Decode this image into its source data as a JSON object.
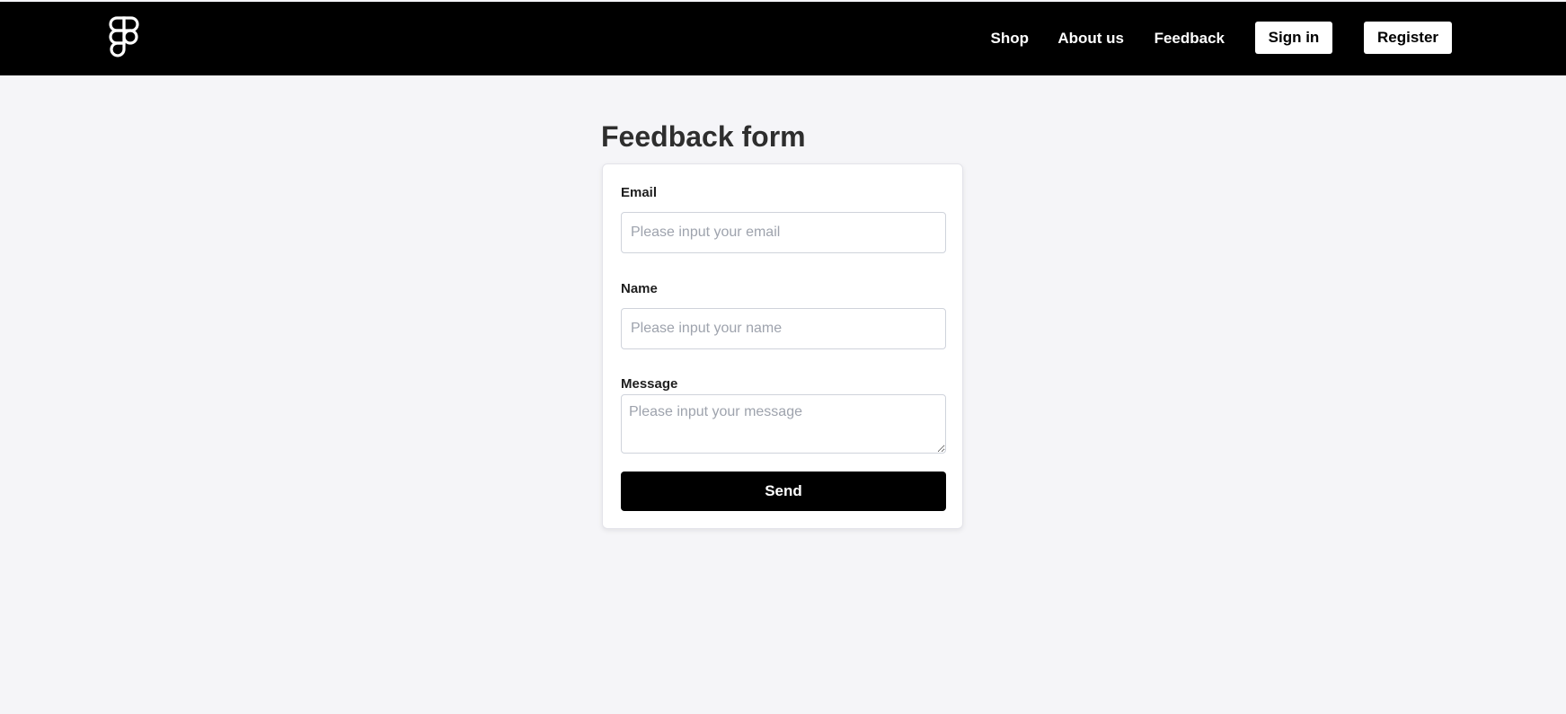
{
  "header": {
    "logo_icon": "figma-logo-icon",
    "nav": {
      "shop": "Shop",
      "about": "About us",
      "feedback": "Feedback"
    },
    "sign_in": "Sign in",
    "register": "Register"
  },
  "page": {
    "title": "Feedback form"
  },
  "form": {
    "email": {
      "label": "Email",
      "placeholder": "Please input your email",
      "value": ""
    },
    "name": {
      "label": "Name",
      "placeholder": "Please input your name",
      "value": ""
    },
    "message": {
      "label": "Message",
      "placeholder": "Please input your message",
      "value": ""
    },
    "submit_label": "Send"
  },
  "colors": {
    "header_bg": "#000000",
    "page_bg": "#f5f5f8",
    "button_primary": "#000000"
  }
}
